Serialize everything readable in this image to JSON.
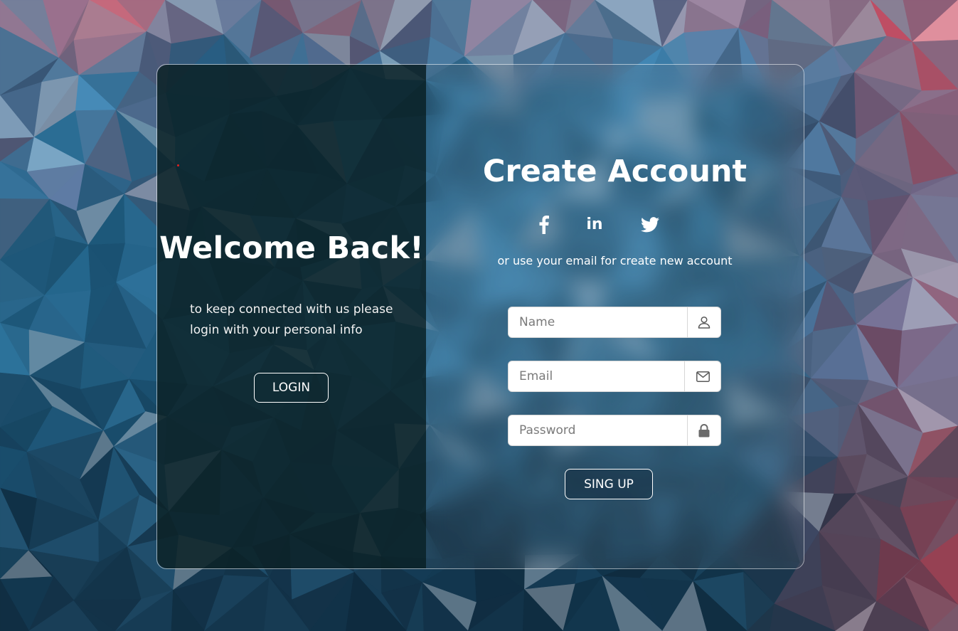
{
  "background": {
    "colors": [
      "#0b2233",
      "#1f5f84",
      "#3f8fbf",
      "#e8394a",
      "#f07a8a",
      "#c9d3de"
    ]
  },
  "welcome": {
    "title": "Welcome Back!",
    "text_line1": "to keep connected with us please",
    "text_line2": "login with your personal info",
    "login_label": "LOGIN"
  },
  "signup": {
    "title": "Create Account",
    "socials": [
      {
        "icon": "facebook-icon"
      },
      {
        "icon": "linkedin-icon",
        "label": "in"
      },
      {
        "icon": "twitter-icon"
      }
    ],
    "subtitle": "or use your email for create new account",
    "fields": {
      "name": {
        "placeholder": "Name",
        "value": "",
        "icon": "user-icon"
      },
      "email": {
        "placeholder": "Email",
        "value": "",
        "icon": "envelope-icon"
      },
      "password": {
        "placeholder": "Password",
        "value": "",
        "icon": "lock-icon"
      }
    },
    "submit_label": "SING UP"
  },
  "colors": {
    "left_panel": "#0c2226",
    "text": "#ffffff",
    "input_bg": "#ffffff",
    "icon": "#5a5a5a"
  }
}
